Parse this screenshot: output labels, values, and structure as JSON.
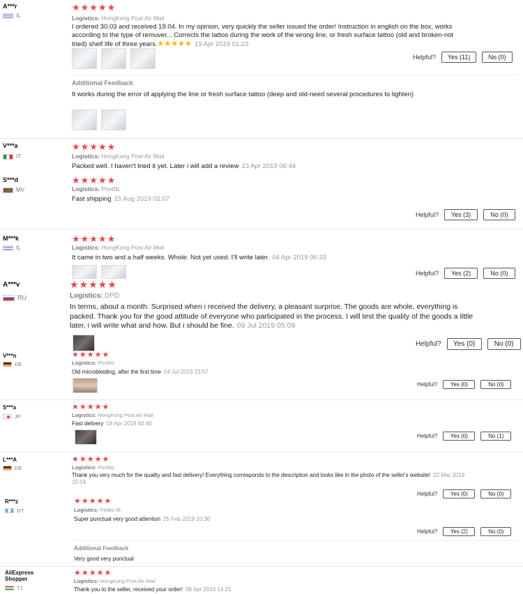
{
  "helpful_label": "Helpful?",
  "reviews": [
    {
      "user": "A***r",
      "country": "IL",
      "stars": "★★★★★",
      "logistics_label": "Logistics:",
      "logistics": "HongKong Post Air Mail",
      "text": "I ordered 30.03 and received 19.04. In my opinion, very quickly the seller issued the order! Instruction in english on the box, works according to the type of remuver... Corrects the tattoo during the work of the wrong line, or fresh surface tattoo (old and broken-not tried) shelf life of three years.",
      "inline_stars": "★★★★★",
      "date": "19 Apr 2019 01:23",
      "yes": "Yes (11)",
      "no": "No (0)",
      "additional_label": "Additional Feedback",
      "additional_text": "It works during the error of applying the line or fresh surface tattoo (deep and old-need several procedures to lighten)"
    },
    {
      "user": "V***a",
      "country": "IT",
      "stars": "★★★★★",
      "logistics_label": "Logistics:",
      "logistics": "HongKong Post Air Mail",
      "text": "Packed well. I haven't tried it yet. Later i will add a review",
      "date": "23 Apr 2019 06:44"
    },
    {
      "user": "S***d",
      "country": "MV",
      "stars": "★★★★★",
      "logistics_label": "Logistics:",
      "logistics": "PostNL",
      "text": "Fast shipping",
      "date": "15 Aug 2019 02:07",
      "yes": "Yes (3)",
      "no": "No (0)"
    },
    {
      "user": "M***k",
      "country": "IL",
      "stars": "★★★★★",
      "logistics_label": "Logistics:",
      "logistics": "HongKong Post Air Mail",
      "text": "It came in two and a half weeks. Whole. Not yet used. I'll write later.",
      "date": "04 Apr 2019 06:33",
      "yes": "Yes (2)",
      "no": "No (0)"
    },
    {
      "user": "A***v",
      "country": "RU",
      "stars": "★★★★★",
      "logistics_label": "Logistics:",
      "logistics": "DPD",
      "text": "In terms, about a month. Surprised when i received the delivery, a pleasant surprise. The goods are whole, everything is packed. Thank you for the good attitude of everyone who participated in the process. I will test the quality of the goods a little later, i will write what and how. But i should be fine.",
      "date": "09 Jul 2019 05:09",
      "yes": "Yes (0)",
      "no": "No (0)"
    },
    {
      "user": "V***n",
      "country": "DE",
      "stars": "★★★★★",
      "logistics_label": "Logistics:",
      "logistics": "PostNL",
      "text": "Old microbleiding, after the first time",
      "date": "04 Jul 2019 23:57",
      "yes": "Yes (0)",
      "no": "No (0)"
    },
    {
      "user": "S***a",
      "country": "JP",
      "stars": "★★★★★",
      "logistics_label": "Logistics:",
      "logistics": "HongKong Post Air Mail",
      "text": "Fast delivery",
      "date": "19 Apr 2019 00:40",
      "yes": "Yes (0)",
      "no": "No (1)"
    },
    {
      "user": "L***A",
      "country": "DE",
      "stars": "★★★★★",
      "logistics_label": "Logistics:",
      "logistics": "PostNL",
      "text": "Thank you very much for the quality and fast delivery! Everything corresponds to the description and looks like in the photo of the seller's website!",
      "date": "22 Mar 2019 15:14",
      "yes": "Yes (0)",
      "no": "No (0)"
    },
    {
      "user": "R***z",
      "country": "GT",
      "stars": "★★★★★",
      "logistics_label": "Logistics:",
      "logistics": "Fedex IE",
      "text": "Super punctual very good attention",
      "date": "25 Feb 2019 10:30",
      "yes": "Yes (2)",
      "no": "No (0)",
      "additional_label": "Additional Feedback",
      "additional_text": "Very good very punctual"
    },
    {
      "user": "AliExpress Shopper",
      "country": "TJ",
      "stars": "★★★★★",
      "logistics_label": "Logistics:",
      "logistics": "HongKong Post Air Mail",
      "text": "Thank you to the seller, received your order!",
      "date": "08 Apr 2019 14:21"
    }
  ]
}
